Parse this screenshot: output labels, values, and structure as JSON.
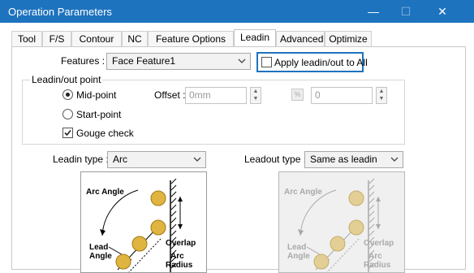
{
  "window": {
    "title": "Operation Parameters",
    "controls": {
      "minimize": "—",
      "maximize": "☐",
      "close": "✕"
    }
  },
  "tabs": [
    {
      "label": "Tool"
    },
    {
      "label": "F/S"
    },
    {
      "label": "Contour"
    },
    {
      "label": "NC"
    },
    {
      "label": "Feature Options"
    },
    {
      "label": "Leadin",
      "active": true
    },
    {
      "label": "Advanced"
    },
    {
      "label": "Optimize"
    }
  ],
  "features": {
    "label": "Features :",
    "value": "Face Feature1",
    "apply_all_label": "Apply leadin/out to All",
    "apply_all_checked": false,
    "highlight_color": "#1e73be"
  },
  "leadin_point": {
    "group_label": "Leadin/out point",
    "mid_point": "Mid-point",
    "start_point": "Start-point",
    "selected": "Mid-point",
    "gouge_check": "Gouge check",
    "gouge_checked": true,
    "offset_label": "Offset :",
    "offset_placeholder": "0mm",
    "count_value": "0",
    "count_icon": "%"
  },
  "leadin": {
    "label": "Leadin type :",
    "value": "Arc",
    "diagram": {
      "arc_angle": "Arc Angle",
      "overlap": "Overlap",
      "lead_angle_1": "Lead",
      "lead_angle_2": "Angle",
      "arc_radius_1": "Arc",
      "arc_radius_2": "Radius"
    }
  },
  "leadout": {
    "label": "Leadout type :",
    "value": "Same as leadin",
    "diagram": {
      "arc_angle": "Arc Angle",
      "overlap": "Overlap",
      "lead_angle_1": "Lead",
      "lead_angle_2": "Angle",
      "arc_radius_1": "Arc",
      "arc_radius_2": "Radius"
    }
  },
  "colors": {
    "titlebar": "#1e73be",
    "tool_ball": "#e0b440",
    "tool_ball_disabled": "#e3cf95"
  }
}
